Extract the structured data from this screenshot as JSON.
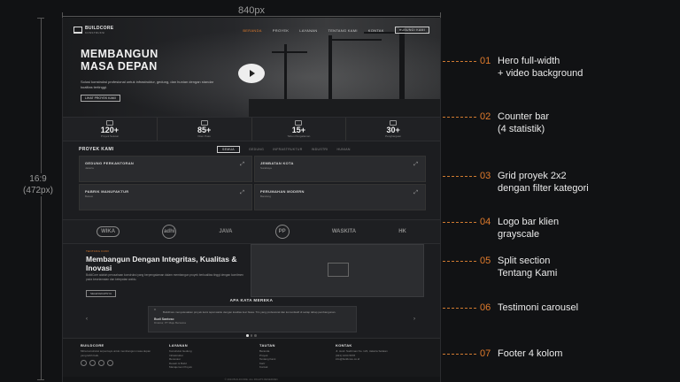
{
  "dimensions": {
    "width_label": "840px",
    "height_label_ratio": "16:9",
    "height_label_px": "(472px)"
  },
  "nav": {
    "brand": "BUILDCORE",
    "brand_tag": "KONSTRUKSI",
    "links": [
      "BERANDA",
      "PROYEK",
      "LAYANAN",
      "TENTANG KAMI",
      "KONTAK"
    ],
    "cta": "HUBUNGI KAMI"
  },
  "hero": {
    "title_line1": "MEMBANGUN",
    "title_line2": "MASA DEPAN",
    "subtitle": "Solusi konstruksi profesional untuk infrastruktur, gedung, dan hunian dengan standar kualitas tertinggi.",
    "button": "LIHAT PROYEK KAMI"
  },
  "stats": [
    {
      "num": "120+",
      "cap": "Proyek Selesai"
    },
    {
      "num": "85+",
      "cap": "Klien Puas"
    },
    {
      "num": "15+",
      "cap": "Tahun Pengalaman"
    },
    {
      "num": "30+",
      "cap": "Penghargaan"
    }
  ],
  "projects": {
    "title": "PROYEK KAMI",
    "filters": [
      "SEMUA",
      "GEDUNG",
      "INFRASTRUKTUR",
      "INDUSTRI",
      "HUNIAN"
    ],
    "cards": [
      {
        "title": "GEDUNG PERKANTORAN",
        "sub": "Jakarta"
      },
      {
        "title": "JEMBATAN KOTA",
        "sub": "Surabaya"
      },
      {
        "title": "PABRIK MANUFAKTUR",
        "sub": "Bekasi"
      },
      {
        "title": "PERUMAHAN MODERN",
        "sub": "Bandung"
      }
    ]
  },
  "clients": [
    "WIKA",
    "adhi",
    "JAVA",
    "PP",
    "WASKITA",
    "HK"
  ],
  "about": {
    "eyebrow": "TENTANG KAMI",
    "title": "Membangun Dengan Integritas, Kualitas & Inovasi",
    "text": "BuildCore adalah perusahaan konstruksi yang berpengalaman dalam membangun proyek berkualitas tinggi dengan komitmen pada keselamatan dan ketepatan waktu.",
    "button": "SELENGKAPNYA"
  },
  "testimonial": {
    "title": "APA KATA MEREKA",
    "quote": "BuildCore menyelesaikan proyek kami tepat waktu dengan kualitas luar biasa. Tim yang profesional dan komunikatif di setiap tahap pembangunan.",
    "name": "Budi Santoso",
    "role": "Direktur, PT Maju Bersama"
  },
  "footer": {
    "col1": {
      "heading": "BUILDCORE",
      "text": "Mitra konstruksi terpercaya untuk membangun masa depan yang lebih baik."
    },
    "col2": {
      "heading": "LAYANAN",
      "items": [
        "Konstruksi Gedung",
        "Infrastruktur",
        "Renovasi",
        "Desain & Build",
        "Manajemen Proyek"
      ]
    },
    "col3": {
      "heading": "TAUTAN",
      "items": [
        "Beranda",
        "Proyek",
        "Tentang Kami",
        "Karir",
        "Kontak"
      ]
    },
    "col4": {
      "heading": "KONTAK",
      "items": [
        "Jl. Jend. Sudirman No. 123, Jakarta Selatan",
        "(021) 1234 5678",
        "info@buildcore.co.id"
      ]
    },
    "copyright": "© 2024 BUILDCORE. ALL RIGHTS RESERVED."
  },
  "annotations": [
    {
      "num": "01",
      "line1": "Hero full-width",
      "line2": "+ video background"
    },
    {
      "num": "02",
      "line1": "Counter bar",
      "line2": "(4 statistik)"
    },
    {
      "num": "03",
      "line1": "Grid proyek 2x2",
      "line2": "dengan filter kategori"
    },
    {
      "num": "04",
      "line1": "Logo bar klien",
      "line2": "grayscale"
    },
    {
      "num": "05",
      "line1": "Split section",
      "line2": "Tentang Kami"
    },
    {
      "num": "06",
      "line1": "Testimoni carousel",
      "line2": ""
    },
    {
      "num": "07",
      "line1": "Footer 4 kolom",
      "line2": ""
    }
  ],
  "colors": {
    "accent": "#e07b2c",
    "background": "#111214",
    "page": "#1c1d20"
  },
  "icons": {
    "play": "play-icon",
    "expand": "expand-icon",
    "quote": "quote-icon"
  }
}
